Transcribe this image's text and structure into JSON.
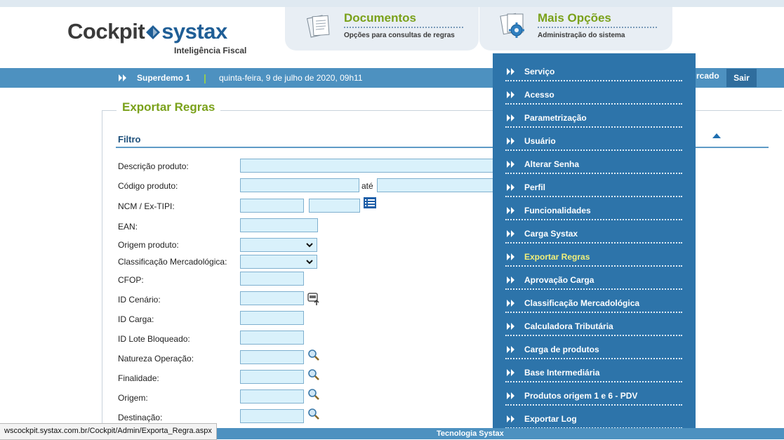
{
  "brand": {
    "logo_left": "Cockpit",
    "logo_right": "systax",
    "tagline": "Inteligência Fiscal",
    "accent": "#7aa11a",
    "primary": "#2d74aa"
  },
  "tabs": [
    {
      "title": "Documentos",
      "subtitle": "Opções para consultas de regras",
      "icon": "documents-icon"
    },
    {
      "title": "Mais Opções",
      "subtitle": "Administração do sistema",
      "icon": "gear-icon"
    }
  ],
  "bar": {
    "user": "Superdemo 1",
    "separator": "|",
    "date": "quinta-feira, 9 de julho de 2020, 09h11",
    "partial_link": "rcado",
    "logout": "Sair"
  },
  "page": {
    "title": "Exportar Regras",
    "section": "Filtro",
    "fields": [
      {
        "label": "Descrição produto:",
        "value": ""
      },
      {
        "label": "Código produto:",
        "value": "",
        "range_label": "até"
      },
      {
        "label": "NCM / Ex-TIPI:",
        "value": ""
      },
      {
        "label": "EAN:",
        "value": ""
      },
      {
        "label": "Origem produto:",
        "value": ""
      },
      {
        "label": "Classificação Mercadológica:",
        "value": ""
      },
      {
        "label": "CFOP:",
        "value": ""
      },
      {
        "label": "ID Cenário:",
        "value": ""
      },
      {
        "label": "ID Carga:",
        "value": ""
      },
      {
        "label": "ID Lote Bloqueado:",
        "value": ""
      },
      {
        "label": "Natureza Operação:",
        "value": ""
      },
      {
        "label": "Finalidade:",
        "value": ""
      },
      {
        "label": "Origem:",
        "value": ""
      },
      {
        "label": "Destinação:",
        "value": ""
      }
    ]
  },
  "menu": {
    "items": [
      {
        "label": "Serviço"
      },
      {
        "label": "Acesso"
      },
      {
        "label": "Parametrização"
      },
      {
        "label": "Usuário"
      },
      {
        "label": "Alterar Senha"
      },
      {
        "label": "Perfil"
      },
      {
        "label": "Funcionalidades"
      },
      {
        "label": "Carga Systax"
      },
      {
        "label": "Exportar Regras",
        "active": true
      },
      {
        "label": "Aprovação Carga"
      },
      {
        "label": "Classificação Mercadológica"
      },
      {
        "label": "Calculadora Tributária"
      },
      {
        "label": "Carga de produtos"
      },
      {
        "label": "Base Intermediária"
      },
      {
        "label": "Produtos origem 1 e 6 - PDV"
      },
      {
        "label": "Exportar Log"
      }
    ]
  },
  "footer": {
    "text": "Tecnologia Systax"
  },
  "status_bar": {
    "url": "wscockpit.systax.com.br/Cockpit/Admin/Exporta_Regra.aspx"
  }
}
